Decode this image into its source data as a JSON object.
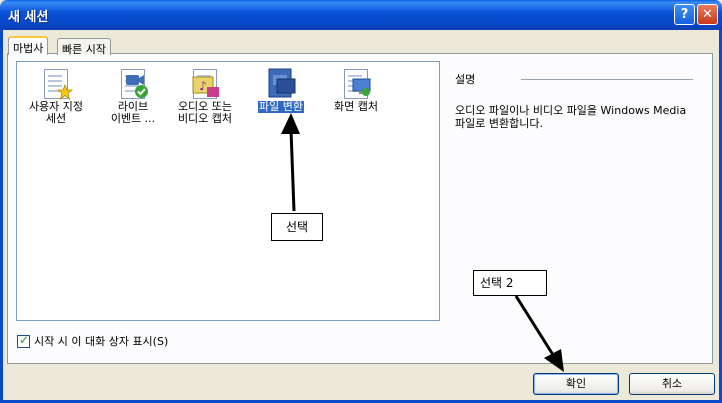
{
  "window": {
    "title": "새 세션",
    "help_glyph": "?",
    "close_glyph": "✕"
  },
  "tabs": [
    {
      "label": "마법사",
      "active": true
    },
    {
      "label": "빠른 시작",
      "active": false
    }
  ],
  "items": [
    {
      "label_line1": "사용자 지정",
      "label_line2": "세션",
      "icon": "custom-session-icon",
      "selected": false
    },
    {
      "label_line1": "라이브",
      "label_line2": "이벤트 ...",
      "icon": "live-event-icon",
      "selected": false
    },
    {
      "label_line1": "오디오 또는",
      "label_line2": "비디오 캡처",
      "icon": "audio-video-capture-icon",
      "selected": false
    },
    {
      "label_line1": "파일 변환",
      "label_line2": "",
      "icon": "file-conversion-icon",
      "selected": true
    },
    {
      "label_line1": "화면 캡처",
      "label_line2": "",
      "icon": "screen-capture-icon",
      "selected": false
    }
  ],
  "description": {
    "heading": "설명",
    "text": "오디오 파일이나 비디오 파일을 Windows Media 파일로 변환합니다."
  },
  "startup_checkbox": {
    "label": "시작 시 이 대화 상자 표시(S)",
    "checked": true
  },
  "buttons": {
    "ok": "확인",
    "cancel": "취소"
  },
  "annotations": {
    "select": "선택",
    "select2": "선택 2"
  },
  "colors": {
    "titlebar": "#0a52d9",
    "selection": "#316ac5",
    "dialog_bg": "#ece9d8"
  }
}
